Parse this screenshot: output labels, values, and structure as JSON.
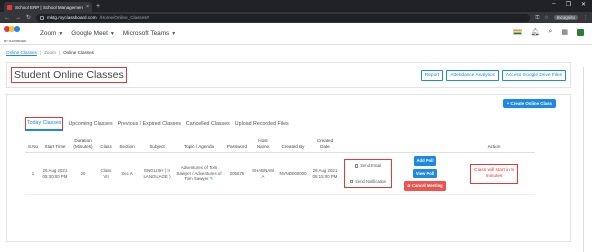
{
  "browser": {
    "tab_title": "School ERP | School Managemen",
    "tab_close": "×",
    "new_tab": "+",
    "url_host": "mktg.myclassboard.com",
    "url_path": "/Home/Online_Classes#",
    "profile_label": "Incognito",
    "window_controls": [
      "–",
      "❐",
      "✕"
    ]
  },
  "app_bar": {
    "logo_text": "MY CLASSBOARD",
    "menu": [
      {
        "label": "Zoom"
      },
      {
        "label": "Google Meet"
      },
      {
        "label": "Microsoft Teams"
      }
    ]
  },
  "breadcrumb": {
    "items": [
      "Online Classes",
      "Zoom",
      "Online Classes"
    ]
  },
  "header": {
    "title": "Student Online Classes",
    "buttons": [
      "Report",
      "Attendance Analytics",
      "Access Google Drive Files"
    ]
  },
  "create_button": "+ Create Online Class",
  "tabs": [
    {
      "label": "Today Classes",
      "active": true
    },
    {
      "label": "Upcoming Classes",
      "active": false
    },
    {
      "label": "Previous / Expired Classes",
      "active": false
    },
    {
      "label": "Cancelled Classes",
      "active": false
    },
    {
      "label": "Upload Recorded Files",
      "active": false
    }
  ],
  "table": {
    "columns": [
      "S.No",
      "Start Time",
      "Duration (Minutes)",
      "Class",
      "Section",
      "Subject",
      "Topic / Agenda",
      "Password",
      "Host Name",
      "Created By",
      "Created Date",
      "",
      "",
      "Action"
    ],
    "row": {
      "sno": "1",
      "start_time": "26 Aug 2021 05:30:00 PM",
      "duration": "20",
      "class": "Class VII",
      "section": "Sec A",
      "subject": "ENGLISH ( II LANGUAGE )",
      "topic": "Adventures of Tom Sawyer / Adventures of Tom Sawyer",
      "password": "205676",
      "host_name": "SHABNAM A",
      "created_by": "NVND000000",
      "created_date": "26 Aug 2021 05:15:00 PM",
      "send_email": "Send Email",
      "send_notification": "Send Notification",
      "add_poll": "Add Poll",
      "view_poll": "View Poll",
      "cancel_meeting": "Cancel Meeting",
      "status": "Class will start in 5 minutes"
    }
  }
}
